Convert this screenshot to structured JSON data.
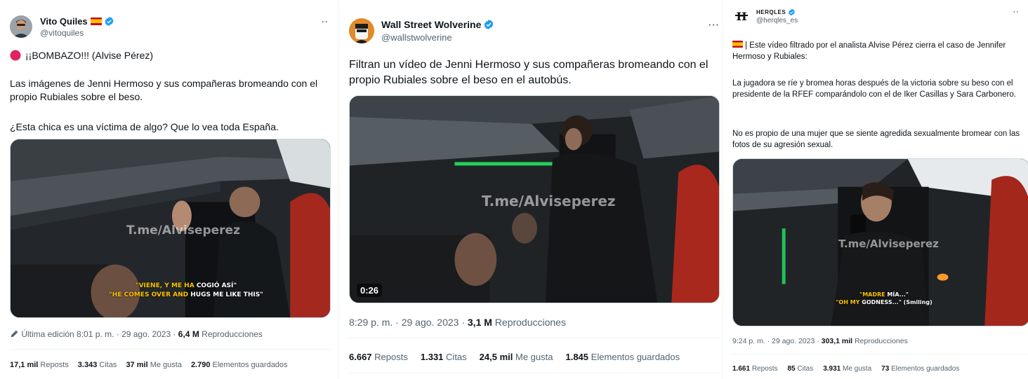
{
  "tweets": [
    {
      "author": {
        "name": "Vito Quiles",
        "handle": "@vitoquiles"
      },
      "more_label": "··",
      "headline": "¡¡BOMBAZO!!! (Alvise Pérez)",
      "text1": "Las imágenes de Jenni Hermoso y sus compañeras bromeando con el propio Rubiales sobre el beso.",
      "text2": "¿Esta chica es una víctima de algo? Que lo vea toda España.",
      "video": {
        "watermark": "T.me/Alviseperez",
        "sub_line1_yellow": "\"VIENE, Y ME HA ",
        "sub_line1_white": "COGIÓ ASÍ\"",
        "sub_line2_yellow": "\"HE COMES OVER AND ",
        "sub_line2_white": "HUGS ME LIKE THIS\""
      },
      "meta_prefix": "Última edición 8:01 p. m. · 29 ago. 2023 · ",
      "views_value": "6,4 M",
      "views_label": " Reproducciones",
      "stats": {
        "reposts_value": "17,1 mil",
        "reposts_label": "Reposts",
        "quotes_value": "3.343",
        "quotes_label": "Citas",
        "likes_value": "37 mil",
        "likes_label": "Me gusta",
        "saves_value": "2.790",
        "saves_label": "Elementos guardados"
      }
    },
    {
      "author": {
        "name": "Wall Street Wolverine",
        "handle": "@wallstwolverine"
      },
      "more_label": "···",
      "text1": "Filtran un vídeo de Jenni Hermoso y sus compañeras bromeando con el propio Rubiales sobre el beso en el autobús.",
      "video": {
        "watermark": "T.me/Alviseperez",
        "duration": "0:26"
      },
      "meta_prefix": "8:29 p. m. · 29 ago. 2023 · ",
      "views_value": "3,1 M",
      "views_label": " Reproducciones",
      "stats": {
        "reposts_value": "6.667",
        "reposts_label": "Reposts",
        "quotes_value": "1.331",
        "quotes_label": "Citas",
        "likes_value": "24,5 mil",
        "likes_label": "Me gusta",
        "saves_value": "1.845",
        "saves_label": "Elementos guardados"
      }
    },
    {
      "author": {
        "name": "HERQLES",
        "handle": "@herqles_es"
      },
      "more_label": "··",
      "text0": "| Este vídeo filtrado por el analista Alvise Pérez cierra el caso de Jennifer Hermoso y Rubiales:",
      "text1": "La jugadora se ríe y bromea horas después de la victoria sobre su beso con el presidente de la RFEF comparándolo con el de Iker Casillas y Sara Carbonero.",
      "text2": "No es propio de una mujer que se siente agredida sexualmente bromear con las fotos de su agresión sexual.",
      "video": {
        "watermark": "T.me/Alviseperez",
        "sub_line1_yellow": "\"MADRE ",
        "sub_line1_white": "MÍA...\"",
        "sub_line2_yellow": "\"OH MY ",
        "sub_line2_white": "GODNESS...\" (Smiling)"
      },
      "meta_prefix": "9:24 p. m. · 29 ago. 2023 · ",
      "views_value": "303,1 mil",
      "views_label": " Reproducciones",
      "stats": {
        "reposts_value": "1.661",
        "reposts_label": "Reposts",
        "quotes_value": "85",
        "quotes_label": "Citas",
        "likes_value": "3.931",
        "likes_label": "Me gusta",
        "saves_value": "73",
        "saves_label": "Elementos guardados"
      }
    }
  ],
  "colors": {
    "verified_blue": "#1d9bf0",
    "text_primary": "#0f1419",
    "text_secondary": "#536471",
    "border": "#cfd9de",
    "divider": "#eff3f4",
    "subtitle_yellow": "#ffc400",
    "headline_dot": "#e0245e"
  },
  "icons": [
    "verified-badge-icon",
    "spain-flag-icon",
    "more-options-icon",
    "red-circle-icon",
    "pencil-edit-icon"
  ]
}
